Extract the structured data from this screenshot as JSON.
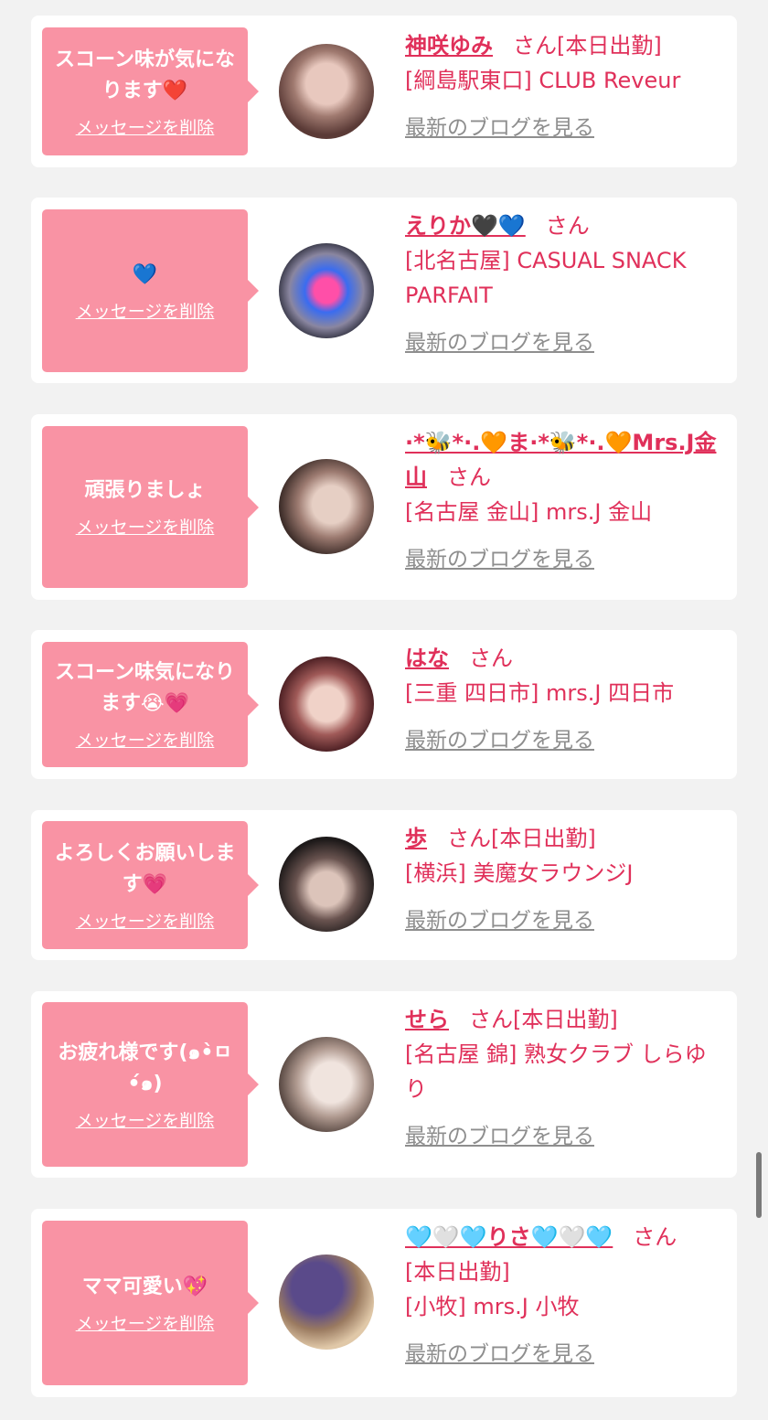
{
  "cards": [
    {
      "message": "スコーン味が気になります❤️",
      "delete_label": "メッセージを削除",
      "name": "神咲ゆみ",
      "honorific": "さん",
      "status": "[本日出勤]",
      "shop": "[綱島駅東口] CLUB Reveur",
      "blog_label": "最新のブログを見る",
      "avatar_colors": [
        "#5a3a36",
        "#a07a70",
        "#e8c8be"
      ]
    },
    {
      "message": "💙",
      "delete_label": "メッセージを削除",
      "name": "えりか🖤💙",
      "honorific": "さん",
      "status": "",
      "shop": "[北名古屋] CASUAL SNACK PARFAIT",
      "blog_label": "最新のブログを見る",
      "avatar_colors": [
        "#3a3a4a",
        "#8a86a0",
        "#d8d4e8"
      ]
    },
    {
      "message": "頑張りましょ",
      "delete_label": "メッセージを削除",
      "name": "·*🐝*·.🧡ま·*🐝*·.🧡Mrs.J金山",
      "honorific": "さん",
      "status": "",
      "shop": "[名古屋 金山] mrs.J 金山",
      "blog_label": "最新のブログを見る",
      "avatar_colors": [
        "#3c2c28",
        "#9c7a70",
        "#e6cfc4"
      ]
    },
    {
      "message": "スコーン味気になります😭💗",
      "delete_label": "メッセージを削除",
      "name": "はな",
      "honorific": "さん",
      "status": "",
      "shop": "[三重 四日市] mrs.J 四日市",
      "blog_label": "最新のブログを見る",
      "avatar_colors": [
        "#4a1e22",
        "#a05a58",
        "#f0d2c8"
      ]
    },
    {
      "message": "よろしくお願いします💗",
      "delete_label": "メッセージを削除",
      "name": "歩",
      "honorific": "さん",
      "status": "[本日出勤]",
      "shop": "[横浜] 美魔女ラウンジJ",
      "blog_label": "最新のブログを見る",
      "avatar_colors": [
        "#1e1a1a",
        "#6a5450",
        "#dcc4ba"
      ]
    },
    {
      "message": "お疲れ様です(๑•̀ㅁ•́๑)",
      "delete_label": "メッセージを削除",
      "name": "せら",
      "honorific": "さん",
      "status": "[本日出勤]",
      "shop": "[名古屋 錦] 熟女クラブ しらゆり",
      "blog_label": "最新のブログを見る",
      "avatar_colors": [
        "#5a4a44",
        "#b09a90",
        "#f0e4de"
      ]
    },
    {
      "message": "ママ可愛い💖",
      "delete_label": "メッセージを削除",
      "name": "🩵🤍🩵りさ🩵🤍🩵",
      "honorific": "さん",
      "status": "[本日出勤]",
      "shop": "[小牧] mrs.J 小牧",
      "blog_label": "最新のブログを見る",
      "avatar_colors": [
        "#5a4a8a",
        "#9a7a60",
        "#e0c8a8"
      ]
    }
  ]
}
